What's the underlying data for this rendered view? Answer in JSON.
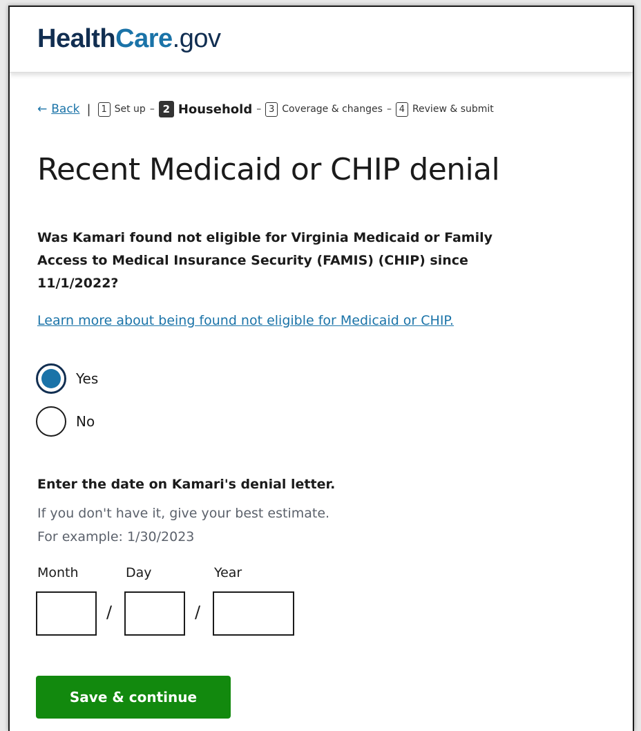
{
  "header": {
    "logo_health": "Health",
    "logo_care": "Care",
    "logo_gov": ".gov"
  },
  "stepnav": {
    "back_label": "Back",
    "back_arrow": "←",
    "separator": "|",
    "steps": [
      {
        "number": "1",
        "label": "Set up",
        "active": false
      },
      {
        "number": "2",
        "label": "Household",
        "active": true
      },
      {
        "number": "3",
        "label": "Coverage & changes",
        "active": false
      },
      {
        "number": "4",
        "label": "Review & submit",
        "active": false
      }
    ],
    "dash": "–"
  },
  "page": {
    "title": "Recent Medicaid or CHIP denial",
    "question": "Was Kamari found not eligible for Virginia Medicaid or Family Access to Medical Insurance Security (FAMIS) (CHIP) since 11/1/2022?",
    "learn_more": "Learn more about being found not eligible for Medicaid or CHIP."
  },
  "radios": [
    {
      "label": "Yes",
      "checked": true
    },
    {
      "label": "No",
      "checked": false
    }
  ],
  "date_section": {
    "label": "Enter the date on Kamari's denial letter.",
    "hint1": "If you don't have it, give your best estimate.",
    "hint2": "For example: 1/30/2023",
    "month_label": "Month",
    "day_label": "Day",
    "year_label": "Year",
    "month_value": "",
    "day_value": "",
    "year_value": "",
    "slash": "/"
  },
  "actions": {
    "save_label": "Save & continue"
  },
  "colors": {
    "brand_navy": "#112e51",
    "link_blue": "#1a73a8",
    "primary_green": "#12890e"
  }
}
